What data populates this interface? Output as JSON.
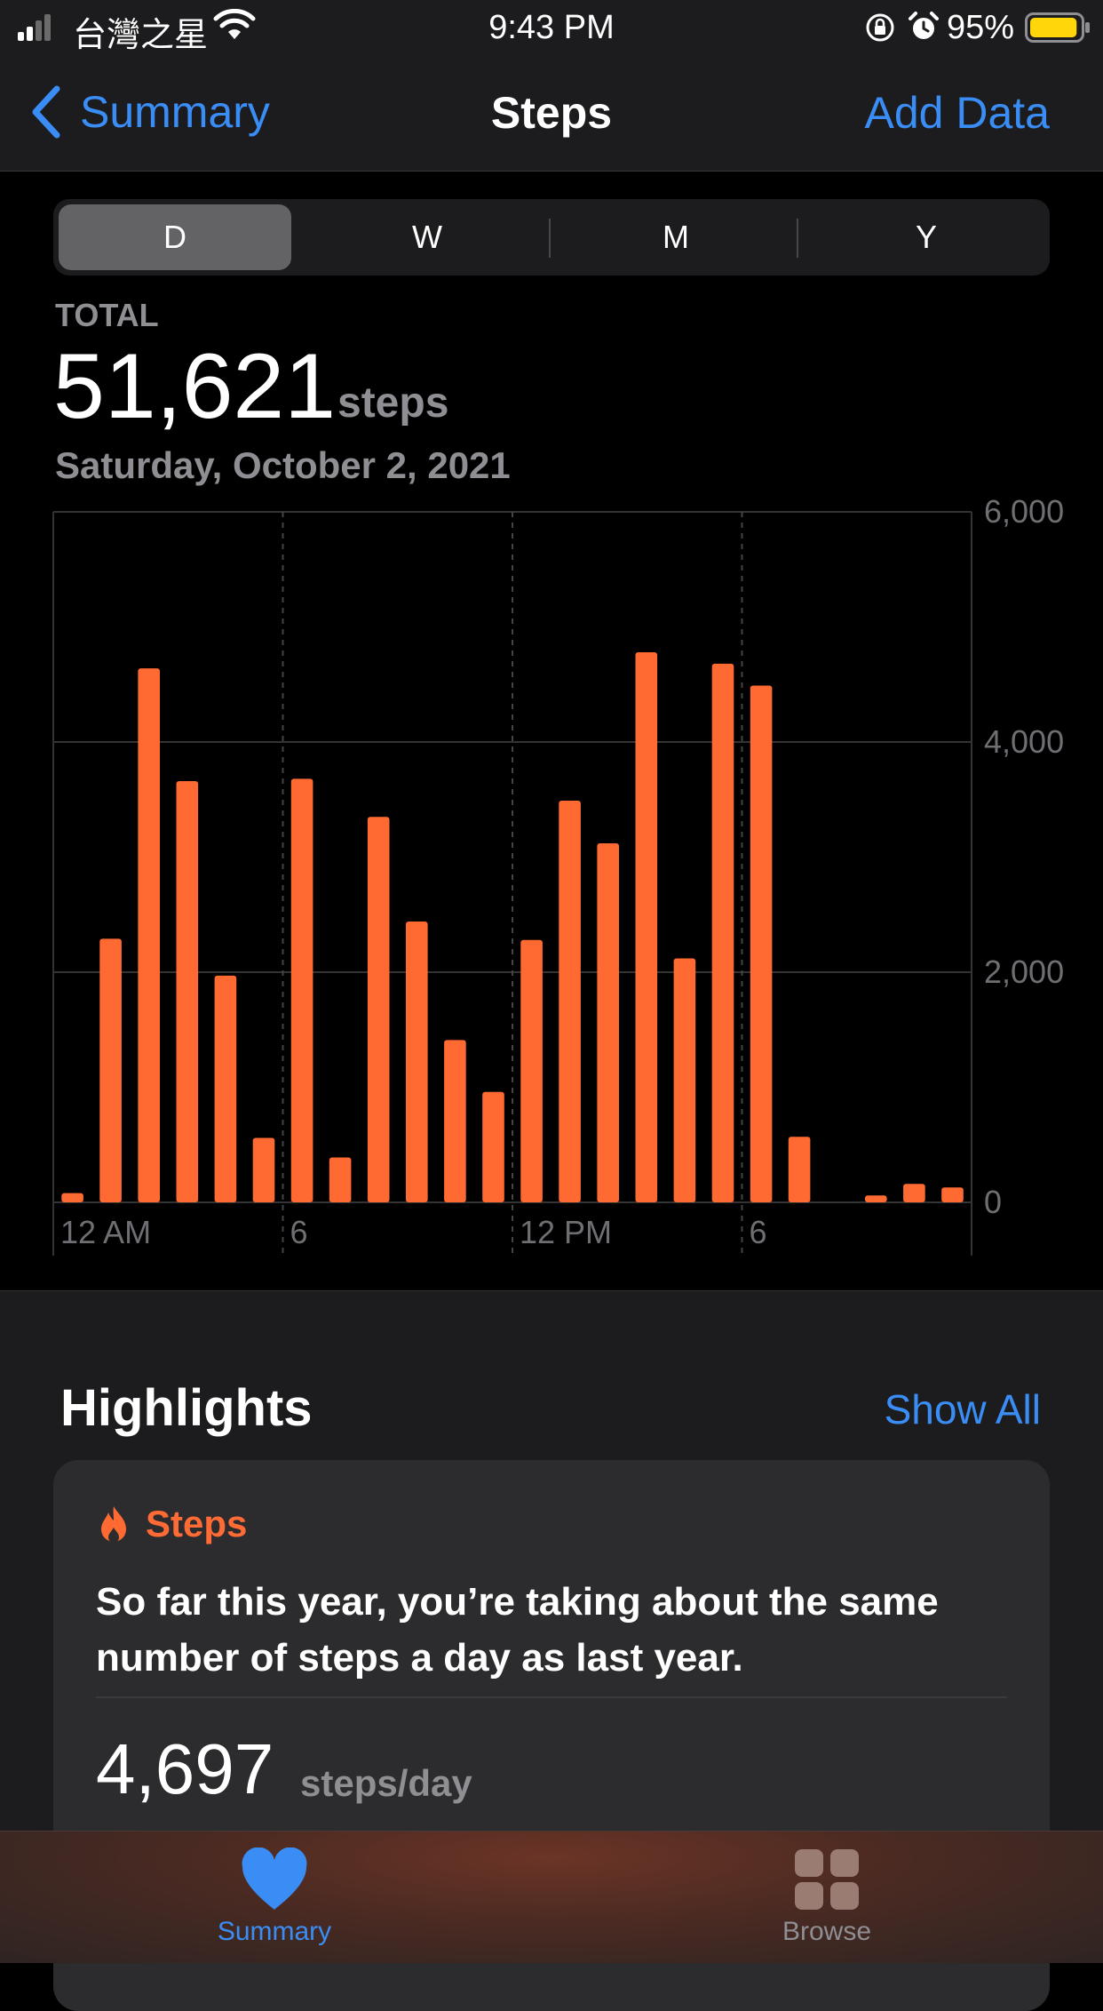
{
  "status_bar": {
    "carrier": "台灣之星",
    "time": "9:43 PM",
    "battery": "95%",
    "battery_level": 0.95,
    "signal_bars": 2
  },
  "nav": {
    "back_label": "Summary",
    "title": "Steps",
    "action_label": "Add Data"
  },
  "segments": [
    {
      "label": "D",
      "active": true
    },
    {
      "label": "W",
      "active": false
    },
    {
      "label": "M",
      "active": false
    },
    {
      "label": "Y",
      "active": false
    }
  ],
  "summary": {
    "total_label": "TOTAL",
    "total_value": "51,621",
    "total_unit": "steps",
    "date": "Saturday, October 2, 2021"
  },
  "chart_data": {
    "type": "bar",
    "x_ticks": [
      "12 AM",
      "6",
      "12 PM",
      "6"
    ],
    "y_ticks": [
      "6,000",
      "4,000",
      "2,000",
      "0"
    ],
    "ylim": [
      0,
      6000
    ],
    "grid": true,
    "bar_color": "#ff6a33",
    "values": [
      80,
      2290,
      4640,
      3660,
      1970,
      560,
      3680,
      390,
      3350,
      2440,
      1410,
      960,
      2280,
      3490,
      3120,
      4780,
      2120,
      4680,
      4490,
      570,
      0,
      60,
      160,
      130
    ]
  },
  "highlights": {
    "title": "Highlights",
    "show_all": "Show All",
    "card": {
      "tag": "Steps",
      "text": "So far this year, you’re taking about the same number of steps a day as last year.",
      "value": "4,697",
      "unit": "steps/day"
    }
  },
  "tabbar": {
    "summary": "Summary",
    "browse": "Browse"
  },
  "colors": {
    "accent_blue": "#3a8df5",
    "steps_orange": "#ff6a33"
  },
  "icons": [
    "signal-icon",
    "wifi-icon",
    "orientation-lock-icon",
    "alarm-icon",
    "battery-icon",
    "chevron-left-icon",
    "flame-icon",
    "heart-icon",
    "grid-icon"
  ]
}
